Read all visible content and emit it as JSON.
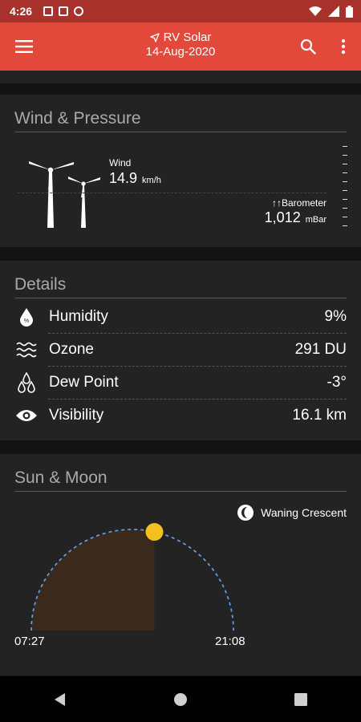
{
  "status_bar": {
    "time": "4:26"
  },
  "app_bar": {
    "title": "RV Solar",
    "subtitle": "14-Aug-2020"
  },
  "wind_pressure": {
    "title": "Wind & Pressure",
    "wind_label": "Wind",
    "wind_value": "14.9",
    "wind_unit": "km/h",
    "barometer_label": "Barometer",
    "barometer_trend": "↑↑",
    "barometer_value": "1,012",
    "barometer_unit": "mBar"
  },
  "details": {
    "title": "Details",
    "rows": [
      {
        "label": "Humidity",
        "value": "9%",
        "icon": "humidity-drop-icon"
      },
      {
        "label": "Ozone",
        "value": "291 DU",
        "icon": "ozone-waves-icon"
      },
      {
        "label": "Dew Point",
        "value": "-3°",
        "icon": "dew-drops-icon"
      },
      {
        "label": "Visibility",
        "value": "16.1 km",
        "icon": "eye-icon"
      }
    ]
  },
  "sun_moon": {
    "title": "Sun & Moon",
    "moon_phase": "Waning Crescent",
    "sunrise": "07:27",
    "sunset": "21:08",
    "sun_progress": 0.57
  },
  "colors": {
    "status_bar": "#a8322b",
    "app_bar": "#e2493b",
    "card": "#232323",
    "sun": "#f2c020",
    "arc": "#5d9be3",
    "day_fill": "#3b2a1b"
  }
}
